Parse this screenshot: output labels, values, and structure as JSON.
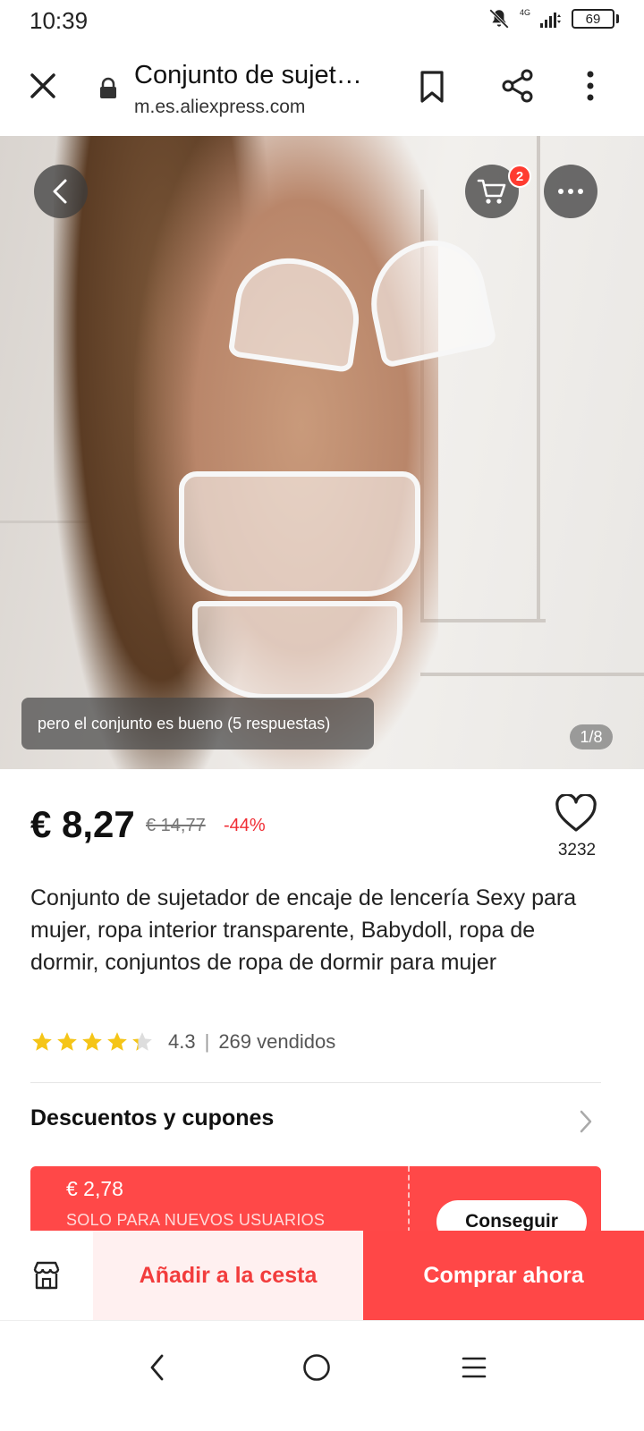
{
  "status_bar": {
    "time": "10:39",
    "network": "4G",
    "battery": "69"
  },
  "browser": {
    "page_title": "Conjunto de sujet…",
    "url": "m.es.aliexpress.com",
    "icons": [
      "close-icon",
      "lock-icon",
      "bookmark-icon",
      "share-icon",
      "more-vert-icon"
    ]
  },
  "gallery": {
    "cart_count": "2",
    "review_snippet": "pero el conjunto es bueno (5 respuestas)",
    "page_indicator": "1/8"
  },
  "product": {
    "price": "€ 8,27",
    "original_price": "€ 14,77",
    "discount": "-44%",
    "wishlist_count": "3232",
    "title": "Conjunto de sujetador de encaje de lencería Sexy para mujer, ropa interior transparente, Babydoll, ropa de dormir, conjuntos de ropa de dormir para mujer",
    "rating": "4.3",
    "rating_stars": 4.3,
    "sold": "269 vendidos"
  },
  "coupons": {
    "section_title": "Descuentos y cupones",
    "coupon_amount": "€ 2,78",
    "coupon_note": "SOLO PARA NUEVOS USUARIOS",
    "coupon_button": "Conseguir"
  },
  "actions": {
    "add_to_cart": "Añadir a la cesta",
    "buy_now": "Comprar ahora"
  },
  "colors": {
    "accent": "#ff4747",
    "accent_light": "#fff0f0",
    "star": "#f5c518"
  }
}
